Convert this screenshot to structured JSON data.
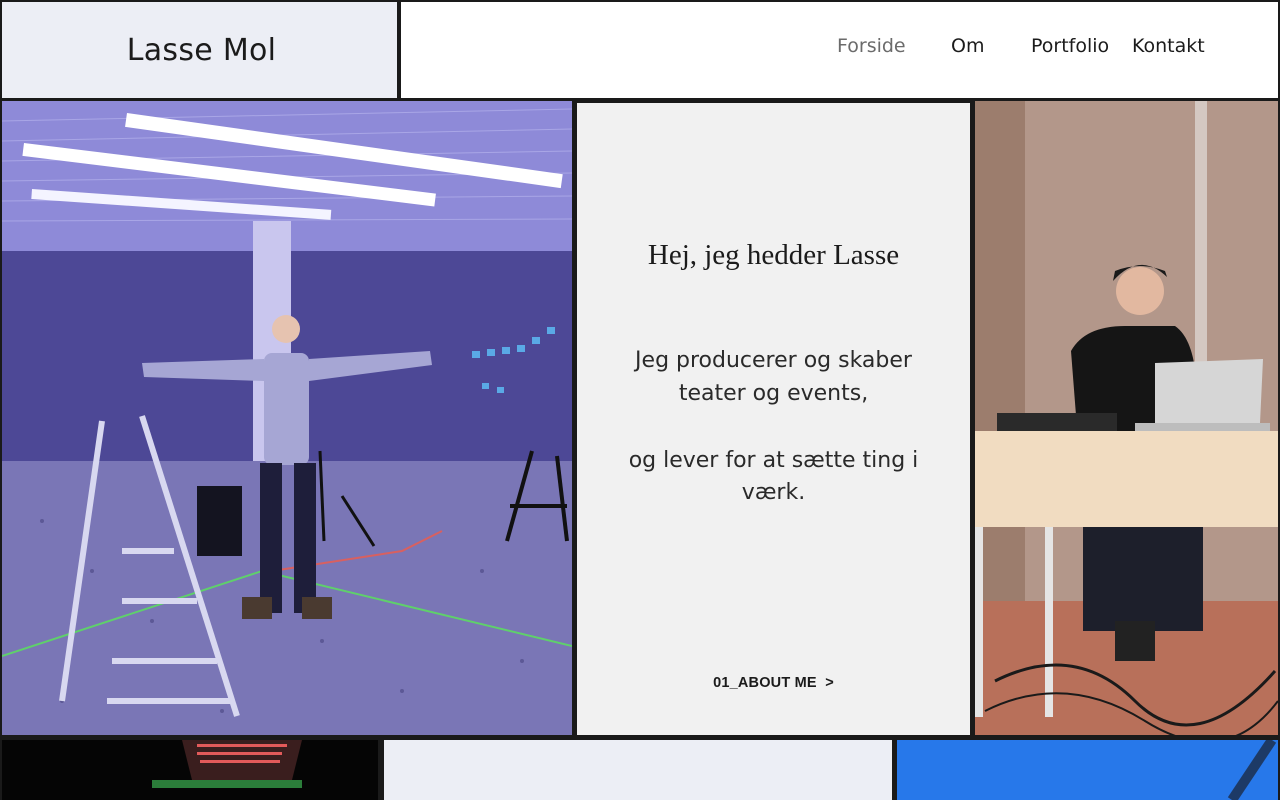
{
  "site": {
    "logo_text": "Lasse Mol"
  },
  "nav": {
    "items": [
      {
        "label": "Forside",
        "active": true
      },
      {
        "label": "Om",
        "active": false
      },
      {
        "label": "Portfolio",
        "active": false
      },
      {
        "label": "Kontakt",
        "active": false
      }
    ]
  },
  "intro": {
    "heading": "Hej, jeg hedder Lasse",
    "paragraph_1": "Jeg producerer og skaber teater og events,",
    "paragraph_2": "og lever for at sætte ting i værk.",
    "link_label": "01_ABOUT ME  >"
  },
  "colors": {
    "text": "#1b1b1b",
    "nav_active": "#6b6b6b",
    "logo_bg": "#eceef5",
    "intro_bg": "#f1f1f1",
    "grid_border": "#1a1a1a"
  }
}
